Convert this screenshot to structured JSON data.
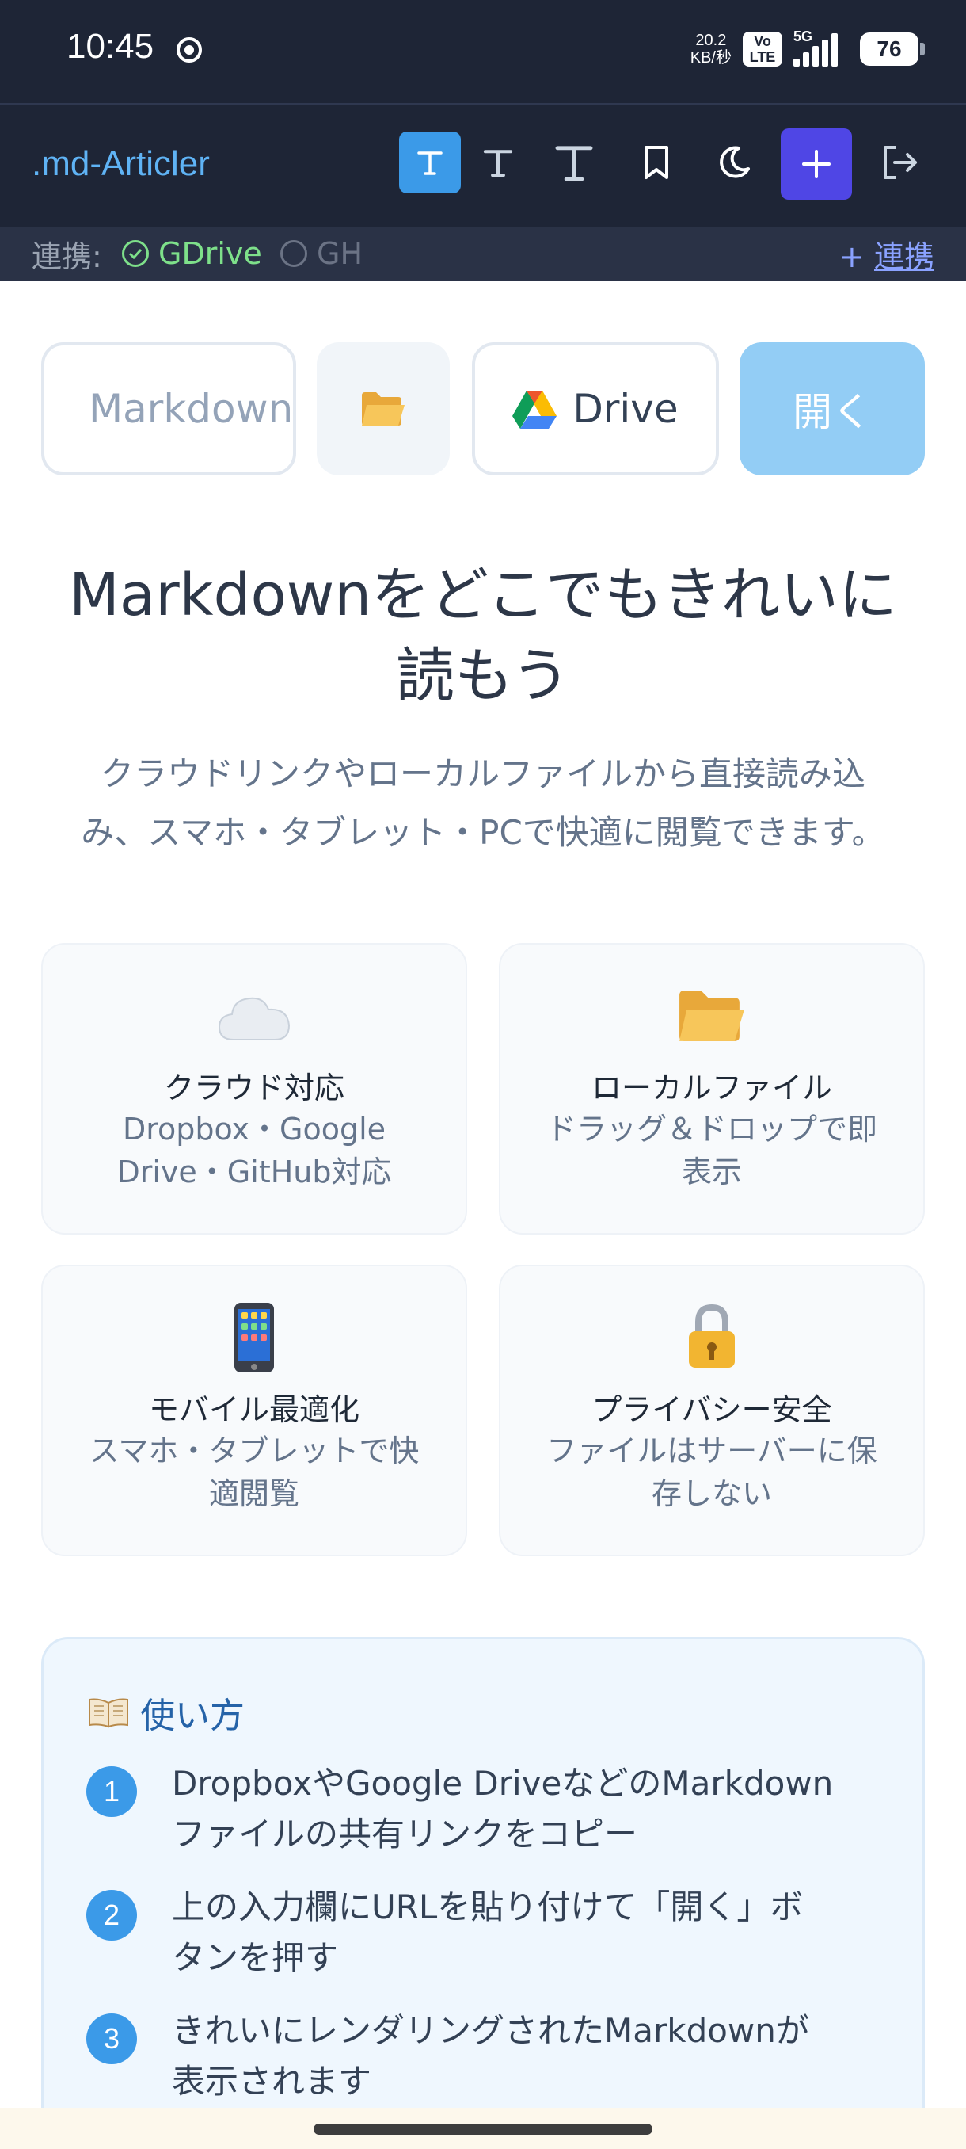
{
  "status_bar": {
    "time": "10:45",
    "net_speed_value": "20.2",
    "net_speed_unit": "KB/秒",
    "volte_top": "Vo",
    "volte_bottom": "LTE",
    "network": "5G",
    "battery": "76"
  },
  "header": {
    "brand": ".md-Articler",
    "tools": [
      {
        "name": "font-size-small",
        "icon": "text-t-icon",
        "active": true
      },
      {
        "name": "font-size-medium",
        "icon": "text-t-icon",
        "active": false
      },
      {
        "name": "font-size-large",
        "icon": "text-t-icon",
        "active": false
      },
      {
        "name": "bookmark",
        "icon": "bookmark-icon",
        "active": false
      },
      {
        "name": "dark-mode",
        "icon": "moon-icon",
        "active": false
      },
      {
        "name": "new",
        "icon": "plus-icon",
        "active": false
      },
      {
        "name": "logout",
        "icon": "logout-icon",
        "active": false
      }
    ],
    "plus_label": "+",
    "accent_color": "#3b9ae8",
    "plus_color": "#4f46e5"
  },
  "connections": {
    "label": "連携:",
    "gdrive": "GDrive",
    "gh": "GH",
    "add_prefix": "+",
    "add_label": "連携"
  },
  "url_bar": {
    "placeholder": "Markdown",
    "folder_icon": "folder-icon",
    "drive_label": "Drive",
    "open_label": "開く"
  },
  "hero": {
    "title_line1": "Markdownをどこでもきれいに",
    "title_line2": "読もう",
    "subtitle_line1": "クラウドリンクやローカルファイルから直接読み込",
    "subtitle_line2": "み、スマホ・タブレット・PCで快適に閲覧できます。"
  },
  "features": [
    {
      "icon": "cloud-icon",
      "title": "クラウド対応",
      "desc_line1": "Dropbox・Google",
      "desc_line2": "Drive・GitHub対応"
    },
    {
      "icon": "folder-icon",
      "title": "ローカルファイル",
      "desc_line1": "ドラッグ＆ドロップで即",
      "desc_line2": "表示"
    },
    {
      "icon": "mobile-phone-icon",
      "title": "モバイル最適化",
      "desc_line1": "スマホ・タブレットで快",
      "desc_line2": "適閲覧"
    },
    {
      "icon": "lock-icon",
      "title": "プライバシー安全",
      "desc_line1": "ファイルはサーバーに保",
      "desc_line2": "存しない"
    }
  ],
  "howto": {
    "title": "使い方",
    "steps": [
      {
        "num": "1",
        "line1": "DropboxやGoogle DriveなどのMarkdown",
        "line2": "ファイルの共有リンクをコピー"
      },
      {
        "num": "2",
        "line1": "上の入力欄にURLを貼り付けて「開く」ボ",
        "line2": "タンを押す"
      },
      {
        "num": "3",
        "line1": "きれいにレンダリングされたMarkdownが",
        "line2": "表示されます"
      }
    ]
  }
}
